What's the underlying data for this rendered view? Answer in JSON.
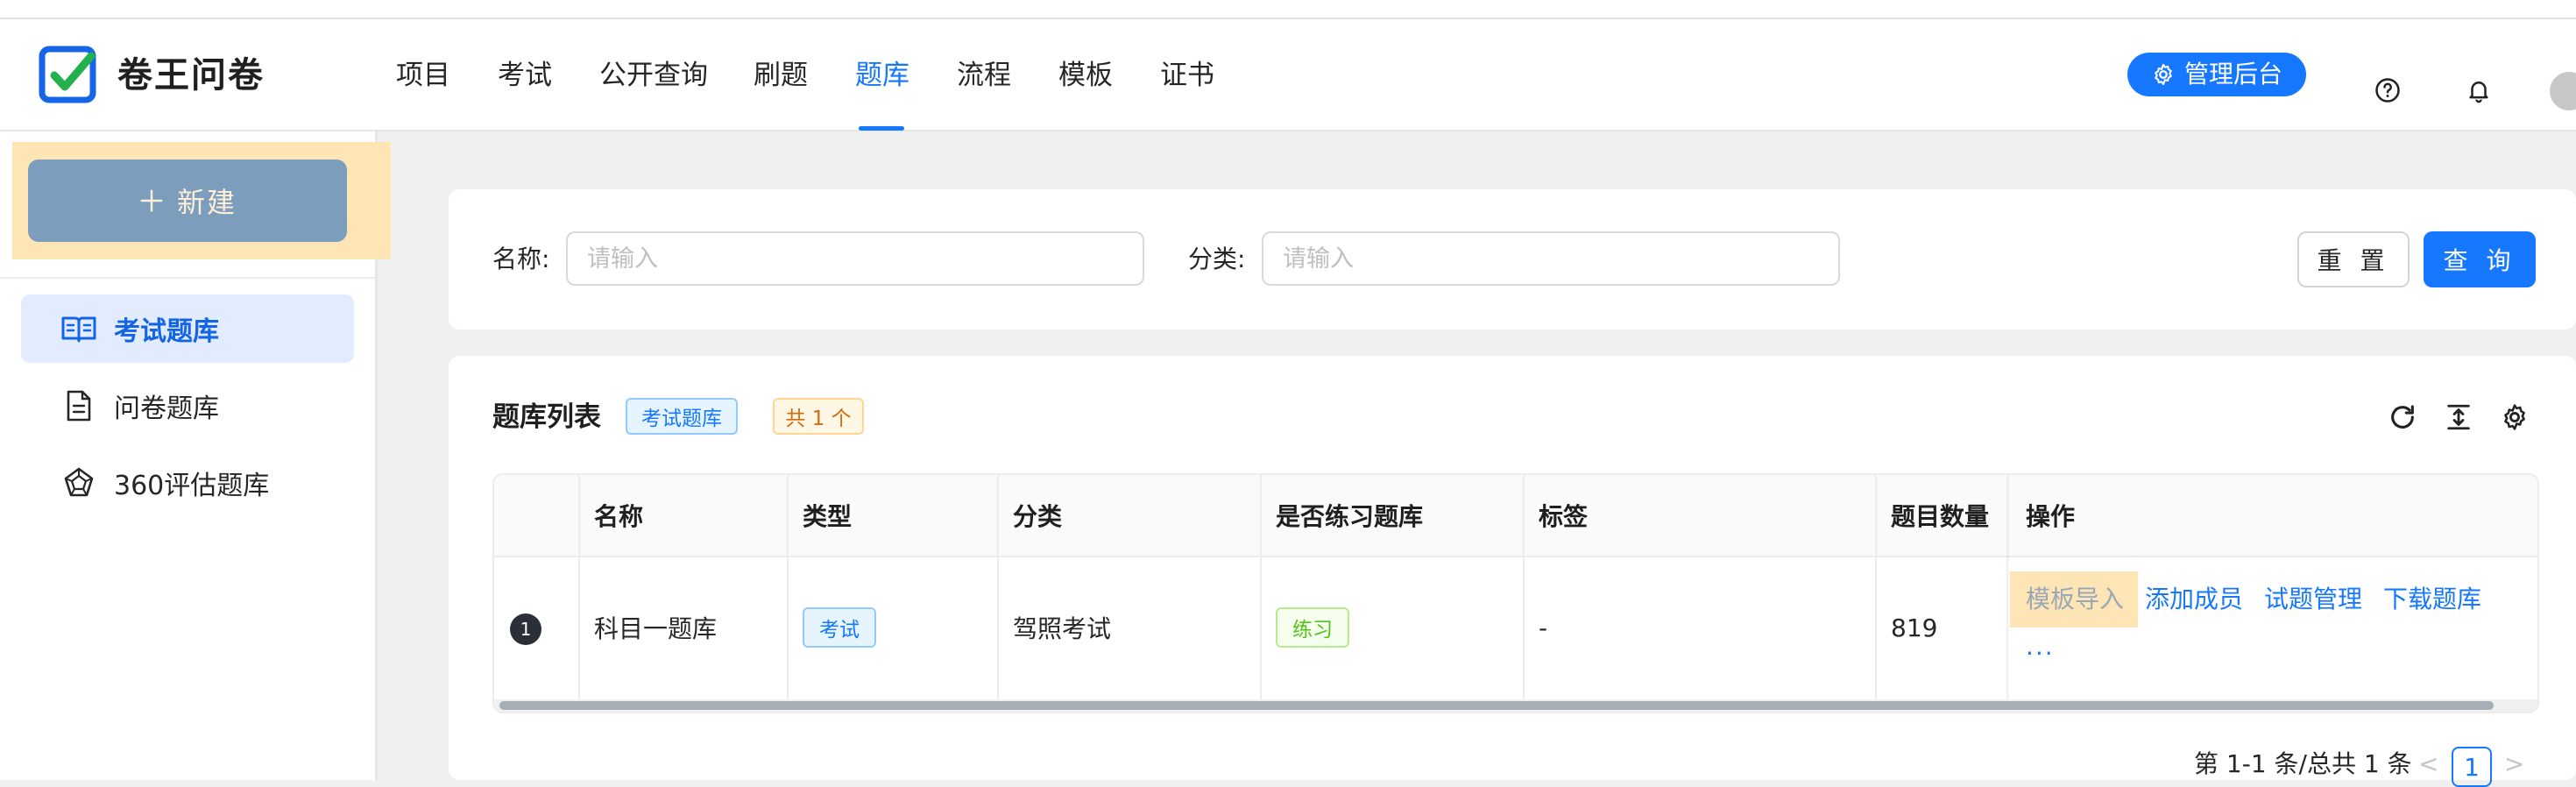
{
  "app": {
    "brand": "卷王问卷"
  },
  "nav": {
    "items": [
      {
        "label": "项目",
        "active": false
      },
      {
        "label": "考试",
        "active": false
      },
      {
        "label": "公开查询",
        "active": false
      },
      {
        "label": "刷题",
        "active": false
      },
      {
        "label": "题库",
        "active": true
      },
      {
        "label": "流程",
        "active": false
      },
      {
        "label": "模板",
        "active": false
      },
      {
        "label": "证书",
        "active": false
      }
    ],
    "admin_label": "管理后台"
  },
  "sidebar": {
    "new_label": "新建",
    "items": [
      {
        "label": "考试题库",
        "icon": "book-open-icon",
        "active": true
      },
      {
        "label": "问卷题库",
        "icon": "document-icon",
        "active": false
      },
      {
        "label": "360评估题库",
        "icon": "pentagon-icon",
        "active": false
      }
    ]
  },
  "search": {
    "name_label": "名称:",
    "name_placeholder": "请输入",
    "category_label": "分类:",
    "category_placeholder": "请输入",
    "reset_label": "重 置",
    "query_label": "查 询"
  },
  "list": {
    "title": "题库列表",
    "scope_tag": "考试题库",
    "count_tag": "共 1 个",
    "columns": [
      "名称",
      "类型",
      "分类",
      "是否练习题库",
      "标签",
      "题目数量",
      "操作"
    ],
    "rows": [
      {
        "index": "1",
        "name": "科目一题库",
        "type": "考试",
        "category": "驾照考试",
        "practice": "练习",
        "tags": "-",
        "question_count": "819",
        "actions": [
          "模板导入",
          "添加成员",
          "试题管理",
          "下载题库"
        ],
        "more": "..."
      }
    ]
  },
  "pagination": {
    "summary": "第 1-1 条/总共 1 条",
    "current_page": "1",
    "prev": "<",
    "next": ">"
  },
  "colors": {
    "primary": "#1677ff",
    "sidebar_active_bg": "#e2ecfe",
    "highlight": "#fde5b5",
    "new_button": "#7d9dbc"
  }
}
